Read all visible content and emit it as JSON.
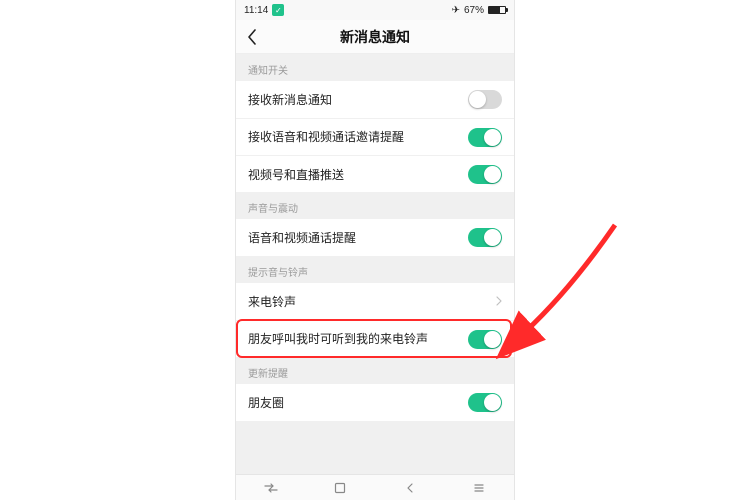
{
  "statusbar": {
    "time": "11:14",
    "battery_pct": "67%",
    "battery_fill_pct": 67
  },
  "nav": {
    "title": "新消息通知"
  },
  "sections": {
    "s1_header": "通知开关",
    "s1_item1": "接收新消息通知",
    "s1_item2": "接收语音和视频通话邀请提醒",
    "s1_item3": "视频号和直播推送",
    "s2_header": "声音与震动",
    "s2_item1": "语音和视频通话提醒",
    "s3_header": "提示音与铃声",
    "s3_item1": "来电铃声",
    "s3_item2": "朋友呼叫我时可听到我的来电铃声",
    "s4_header": "更新提醒",
    "s4_item1": "朋友圈"
  },
  "toggles": {
    "receive_new_msg": false,
    "receive_av_invite": true,
    "video_channel_push": true,
    "av_call_alert": true,
    "friend_hear_ringtone": true,
    "moments": true
  },
  "colors": {
    "accent": "#1fc28b",
    "arrow": "#ff2a2a"
  }
}
